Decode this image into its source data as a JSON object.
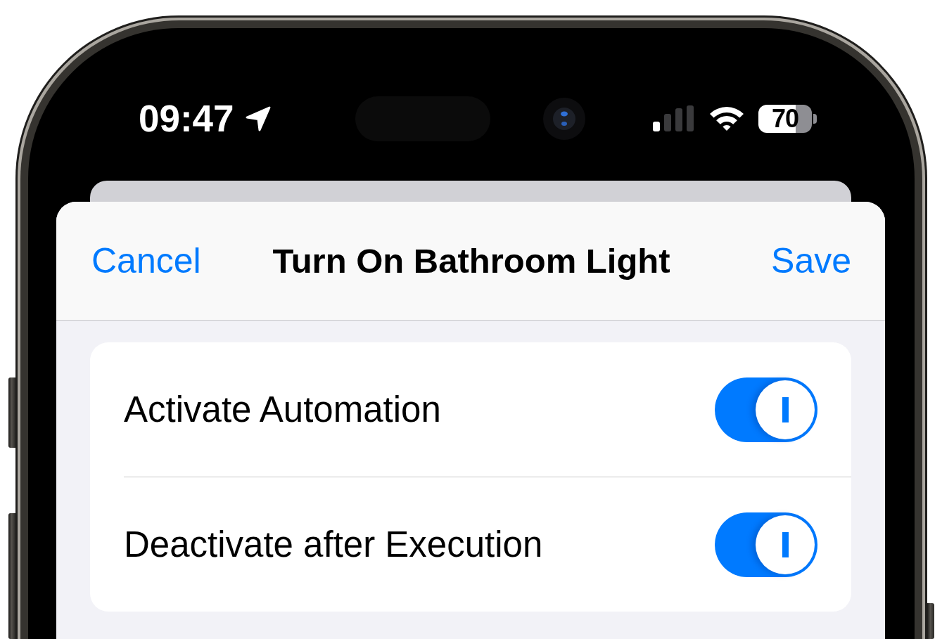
{
  "status_bar": {
    "time": "09:47",
    "battery": "70"
  },
  "navigation_bar": {
    "cancel_button": "Cancel",
    "title": "Turn On Bathroom Light",
    "save_button": "Save"
  },
  "settings": [
    {
      "label": "Activate Automation",
      "on": true
    },
    {
      "label": "Deactivate after Execution",
      "on": true
    }
  ]
}
